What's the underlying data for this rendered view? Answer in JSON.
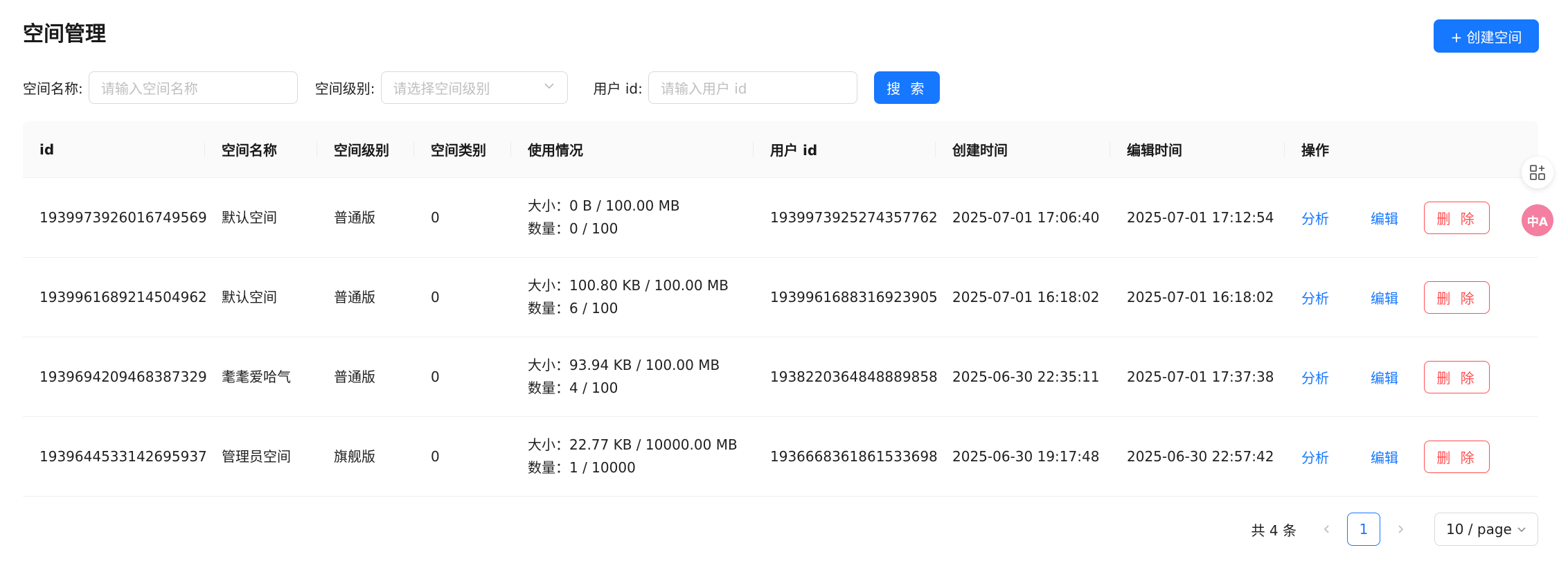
{
  "header": {
    "title": "空间管理",
    "create_label": "+ 创建空间"
  },
  "filters": {
    "name_label": "空间名称:",
    "name_placeholder": "请输入空间名称",
    "level_label": "空间级别:",
    "level_placeholder": "请选择空间级别",
    "user_label": "用户 id:",
    "user_placeholder": "请输入用户 id",
    "search_label": "搜 索"
  },
  "table": {
    "columns": [
      "id",
      "空间名称",
      "空间级别",
      "空间类别",
      "使用情况",
      "用户 id",
      "创建时间",
      "编辑时间",
      "操作"
    ],
    "rows": [
      {
        "id": "1939973926016749569",
        "name": "默认空间",
        "level": "普通版",
        "type": "0",
        "size": "大小：0 B / 100.00 MB",
        "count": "数量：0 / 100",
        "user_id": "1939973925274357762",
        "created": "2025-07-01 17:06:40",
        "edited": "2025-07-01 17:12:54"
      },
      {
        "id": "1939961689214504962",
        "name": "默认空间",
        "level": "普通版",
        "type": "0",
        "size": "大小：100.80 KB / 100.00 MB",
        "count": "数量：6 / 100",
        "user_id": "1939961688316923905",
        "created": "2025-07-01 16:18:02",
        "edited": "2025-07-01 16:18:02"
      },
      {
        "id": "1939694209468387329",
        "name": "耄耄爱哈气",
        "level": "普通版",
        "type": "0",
        "size": "大小：93.94 KB / 100.00 MB",
        "count": "数量：4 / 100",
        "user_id": "1938220364848889858",
        "created": "2025-06-30 22:35:11",
        "edited": "2025-07-01 17:37:38"
      },
      {
        "id": "1939644533142695937",
        "name": "管理员空间",
        "level": "旗舰版",
        "type": "0",
        "size": "大小：22.77 KB / 10000.00 MB",
        "count": "数量：1 / 10000",
        "user_id": "1936668361861533698",
        "created": "2025-06-30 19:17:48",
        "edited": "2025-06-30 22:57:42"
      }
    ],
    "actions": {
      "analyze": "分析",
      "edit": "编辑",
      "delete": "删 除"
    }
  },
  "pagination": {
    "total": "共 4 条",
    "current": "1",
    "page_size": "10 / page",
    "prev_icon": "chevron-left-icon",
    "next_icon": "chevron-right-icon"
  },
  "floating_tools": {
    "apps_icon": "apps-grid-icon",
    "translate_icon": "translate-icon",
    "translate_text": "中A"
  },
  "colors": {
    "primary": "#1677ff",
    "danger": "#ff4d4f",
    "header_bg": "#fafafa",
    "translate_bg": "#f47fa0"
  }
}
